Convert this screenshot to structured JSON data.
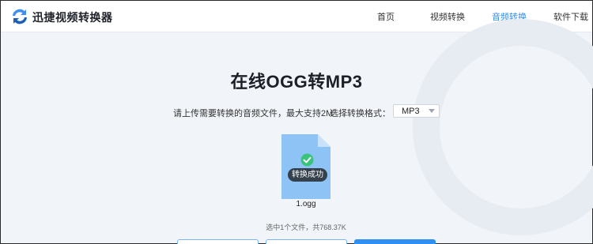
{
  "header": {
    "brand": "迅捷视频转换器",
    "brand_icon": "swap-arrows-logo-icon",
    "nav": [
      {
        "label": "首页",
        "active": false
      },
      {
        "label": "视频转换",
        "active": false
      },
      {
        "label": "音频转换",
        "active": true
      },
      {
        "label": "软件下载",
        "active": false
      }
    ]
  },
  "main": {
    "title": "在线OGG转MP3",
    "upload_hint": "请上传需要转换的音频文件，最大支持2M",
    "format_label": "选择转换格式：",
    "format_value": "MP3"
  },
  "file": {
    "status": "转换成功",
    "name": "1.ogg",
    "icon": "check-circle-icon"
  },
  "summary": "选中1个文件，共768.37K",
  "colors": {
    "accent": "#2f8ff2",
    "background": "#f1f4f8",
    "success": "#39c47a"
  }
}
